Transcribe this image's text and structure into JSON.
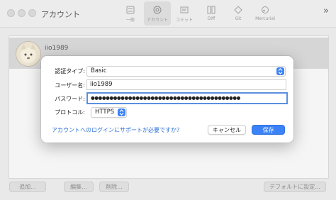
{
  "window": {
    "title": "アカウント"
  },
  "toolbar": {
    "items": [
      {
        "label": "一般",
        "icon": "switch-icon"
      },
      {
        "label": "アカウント",
        "icon": "at-icon"
      },
      {
        "label": "コミット",
        "icon": "commit-icon"
      },
      {
        "label": "Diff",
        "icon": "diff-icon"
      },
      {
        "label": "Git",
        "icon": "git-icon"
      },
      {
        "label": "Mercurial",
        "icon": "mercurial-icon"
      }
    ],
    "active_index": 1
  },
  "accounts": [
    {
      "name": "iio1989"
    }
  ],
  "bottom_buttons": {
    "add": "追加...",
    "edit": "編集...",
    "delete": "削除...",
    "default": "デフォルトに設定..."
  },
  "dialog": {
    "auth_type_label": "認証タイプ:",
    "auth_type_value": "Basic",
    "username_label": "ユーザー名:",
    "username_value": "iio1989",
    "password_label": "パスワード:",
    "password_value": "●●●●●●●●●●●●●●●●●●●●●●●●●●●●●●●●●●●●●●●●",
    "protocol_label": "プロトコル:",
    "protocol_value": "HTTPS",
    "help_link": "アカウントへのログインにサポートが必要ですか？",
    "cancel_label": "キャンセル",
    "save_label": "保存"
  },
  "colors": {
    "accent": "#3b82f6",
    "link": "#2b6fd6"
  }
}
